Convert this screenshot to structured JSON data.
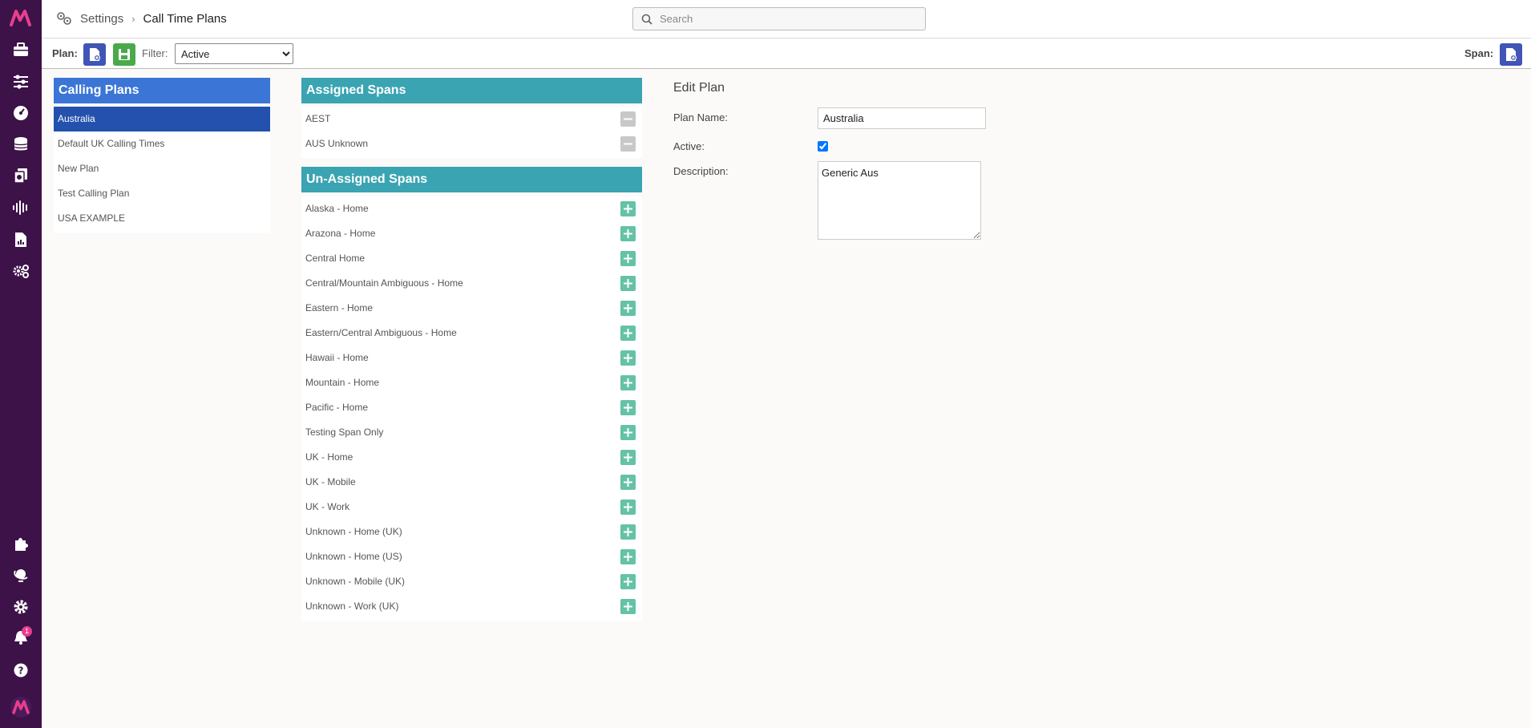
{
  "header": {
    "breadcrumb_root": "Settings",
    "breadcrumb_sep": "›",
    "breadcrumb_current": "Call Time Plans",
    "search_placeholder": "Search"
  },
  "rail": {
    "notification_count": "1",
    "icons": [
      "logo-icon",
      "briefcase-icon",
      "sliders-icon",
      "dashboard-icon",
      "database-icon",
      "documents-icon",
      "waveform-icon",
      "report-icon",
      "settings-cogs-icon",
      "puzzle-icon",
      "globe-icon",
      "gear-icon",
      "bell-icon",
      "help-icon",
      "brand-logo-icon"
    ]
  },
  "toolbar": {
    "plan_label": "Plan:",
    "filter_label": "Filter:",
    "filter_value": "Active",
    "filter_options": [
      "Active"
    ],
    "span_label": "Span:"
  },
  "calling_plans": {
    "title": "Calling Plans",
    "items": [
      {
        "label": "Australia",
        "selected": true
      },
      {
        "label": "Default UK Calling Times",
        "selected": false
      },
      {
        "label": "New Plan",
        "selected": false
      },
      {
        "label": "Test Calling Plan",
        "selected": false
      },
      {
        "label": "USA EXAMPLE",
        "selected": false
      }
    ]
  },
  "assigned_spans": {
    "title": "Assigned Spans",
    "items": [
      "AEST",
      "AUS Unknown"
    ]
  },
  "unassigned_spans": {
    "title": "Un-Assigned Spans",
    "items": [
      "Alaska - Home",
      "Arazona - Home",
      "Central Home",
      "Central/Mountain Ambiguous - Home",
      "Eastern - Home",
      "Eastern/Central Ambiguous - Home",
      "Hawaii - Home",
      "Mountain - Home",
      "Pacific - Home",
      "Testing Span Only",
      "UK - Home",
      "UK - Mobile",
      "UK - Work",
      "Unknown - Home (UK)",
      "Unknown - Home (US)",
      "Unknown - Mobile (UK)",
      "Unknown - Work (UK)"
    ]
  },
  "edit_plan": {
    "title": "Edit Plan",
    "name_label": "Plan Name:",
    "name_value": "Australia",
    "active_label": "Active:",
    "active_checked": true,
    "description_label": "Description:",
    "description_value": "Generic Aus"
  },
  "colors": {
    "rail_bg": "#3c1249",
    "accent_magenta": "#e83e8c",
    "head_blue": "#3b76d6",
    "selected_blue": "#2351ad",
    "head_teal": "#3aa4b2",
    "plus_green": "#65c2a7",
    "minus_grey": "#c8c8c8"
  }
}
